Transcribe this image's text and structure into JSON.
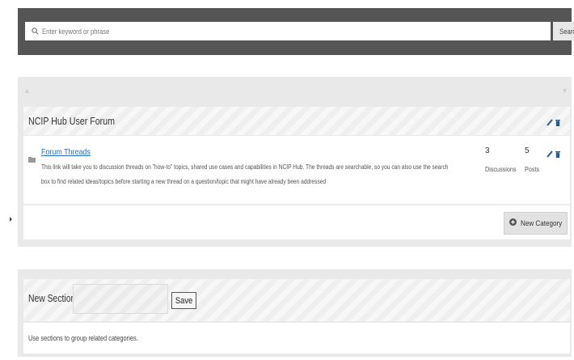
{
  "search": {
    "placeholder": "Enter keyword or phrase",
    "button_label": "Search"
  },
  "category_section": {
    "title": "NCIP Hub User Forum",
    "categories": [
      {
        "title": "Forum Threads",
        "description": "This link will take you to discussion threads on \"how-to\" topics, shared use cases and capabilities in NCIP Hub. The threads are searchable, so you can also use the search box to find related ideas/topics before starting a new thread on a question/topic that might have already been addressed",
        "discussions_count": "3",
        "discussions_label": "Discussions",
        "posts_count": "5",
        "posts_label": "Posts"
      }
    ],
    "new_category_label": "New Category"
  },
  "new_section": {
    "label": "New Section",
    "save_label": "Save",
    "help_text": "Use sections to group related categories."
  },
  "colors": {
    "link": "#2a6ebb",
    "icon": "#2a5a8a",
    "search_bar_bg": "#555555",
    "panel_bg": "#e9e9e9"
  },
  "icons": [
    "search-icon",
    "arrow-up-icon",
    "arrow-down-icon",
    "pencil-icon",
    "trash-icon",
    "folder-icon",
    "plus-circle-icon",
    "caret-right-icon"
  ]
}
